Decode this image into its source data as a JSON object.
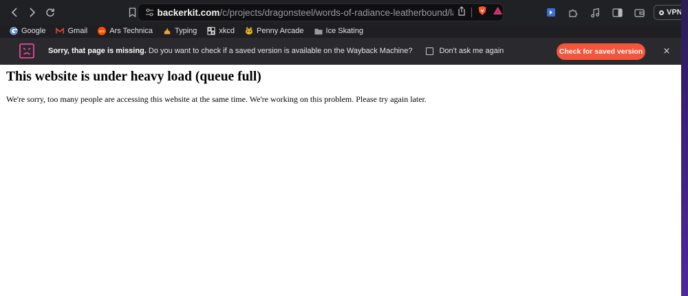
{
  "url": {
    "host": "backerkit.com",
    "path": "/c/projects/dragonsteel/words-of-radiance-leatherbound/launch_pa..."
  },
  "toolbar": {
    "vpn_label": "VPN"
  },
  "bookmarks": [
    {
      "label": "Google",
      "icon": "google-icon"
    },
    {
      "label": "Gmail",
      "icon": "gmail-icon"
    },
    {
      "label": "Ars Technica",
      "icon": "ars-technica-icon"
    },
    {
      "label": "Typing",
      "icon": "typing-icon"
    },
    {
      "label": "xkcd",
      "icon": "xkcd-icon"
    },
    {
      "label": "Penny Arcade",
      "icon": "penny-arcade-icon"
    },
    {
      "label": "Ice Skating",
      "icon": "folder-icon"
    }
  ],
  "banner": {
    "title": "Sorry, that page is missing.",
    "message": "Do you want to check if a saved version is available on the Wayback Machine?",
    "checkbox_label": "Don't ask me again",
    "button_label": "Check for saved version",
    "close_glyph": "×"
  },
  "page": {
    "heading": "This website is under heavy load (queue full)",
    "message": "We're sorry, too many people are accessing this website at the same time. We're working on this problem. Please try again later."
  },
  "colors": {
    "accent_button": "#f4553b",
    "banner_bg": "#2a2a2e",
    "toolbar_bg": "#202124"
  }
}
